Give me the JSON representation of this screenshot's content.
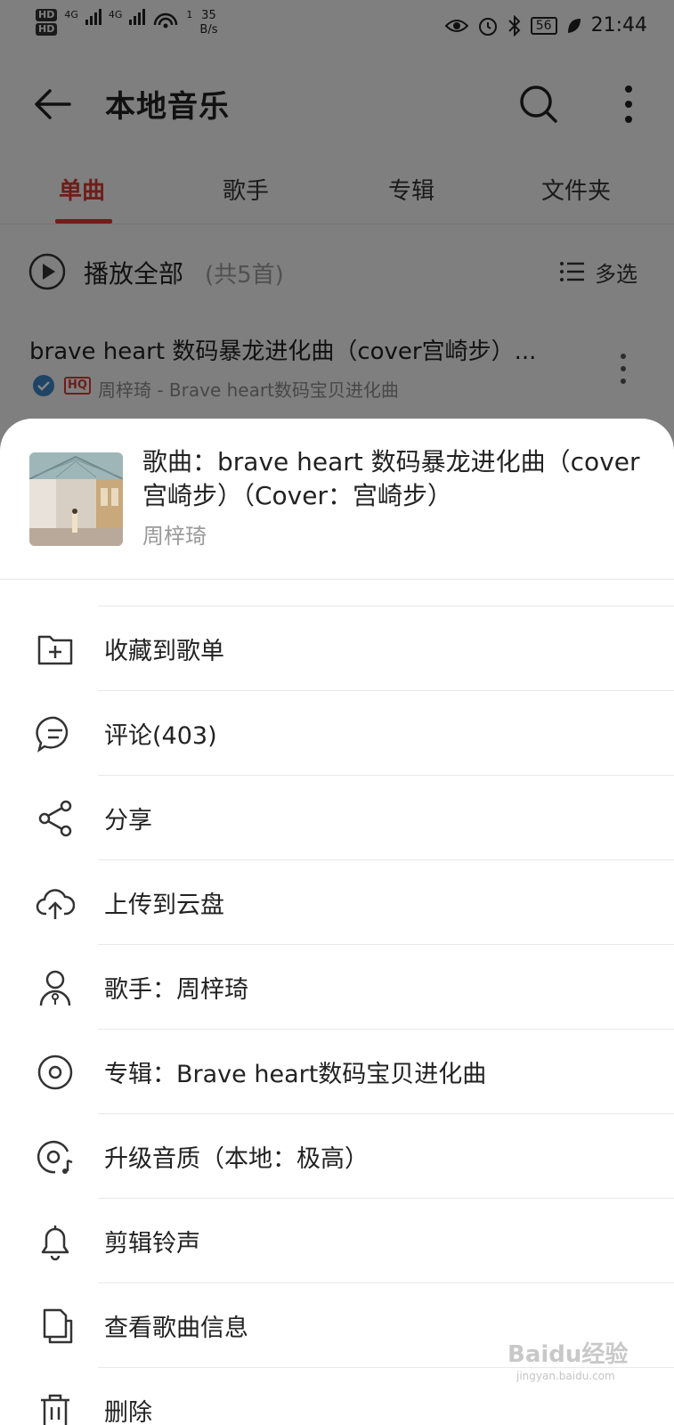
{
  "status_bar": {
    "hd1": "HD",
    "hd2": "HD",
    "net1": "4G",
    "net2": "4G",
    "hotspot_count": "1",
    "speed_value": "35",
    "speed_unit": "B/s",
    "battery": "56",
    "time": "21:44"
  },
  "app_bar": {
    "title": "本地音乐"
  },
  "tabs": [
    {
      "label": "单曲",
      "active": true
    },
    {
      "label": "歌手",
      "active": false
    },
    {
      "label": "专辑",
      "active": false
    },
    {
      "label": "文件夹",
      "active": false
    }
  ],
  "play_all": {
    "label": "播放全部",
    "count": "(共5首)",
    "multi_select": "多选"
  },
  "song": {
    "title": "brave heart 数码暴龙进化曲（cover宫崎步）...",
    "quality_badge": "HQ",
    "subtitle": "周梓琦 - Brave heart数码宝贝进化曲"
  },
  "sheet": {
    "song_title": "歌曲：brave heart 数码暴龙进化曲（cover宫崎步）（Cover：宫崎步）",
    "artist": "周梓琦",
    "menu": [
      {
        "icon": "add-to-playlist-icon",
        "label": "收藏到歌单"
      },
      {
        "icon": "comment-icon",
        "label": "评论(403)"
      },
      {
        "icon": "share-icon",
        "label": "分享"
      },
      {
        "icon": "cloud-upload-icon",
        "label": "上传到云盘"
      },
      {
        "icon": "artist-icon",
        "label": "歌手：周梓琦"
      },
      {
        "icon": "album-icon",
        "label": "专辑：Brave heart数码宝贝进化曲"
      },
      {
        "icon": "quality-upgrade-icon",
        "label": "升级音质（本地：极高）"
      },
      {
        "icon": "bell-icon",
        "label": "剪辑铃声"
      },
      {
        "icon": "song-info-icon",
        "label": "查看歌曲信息"
      },
      {
        "icon": "trash-icon",
        "label": "删除"
      }
    ]
  },
  "watermark": {
    "text": "Baidu经验",
    "sub": "jingyan.baidu.com"
  },
  "colors": {
    "accent": "#d33a31",
    "background": "#f4f4f4",
    "sheet": "#ffffff"
  }
}
